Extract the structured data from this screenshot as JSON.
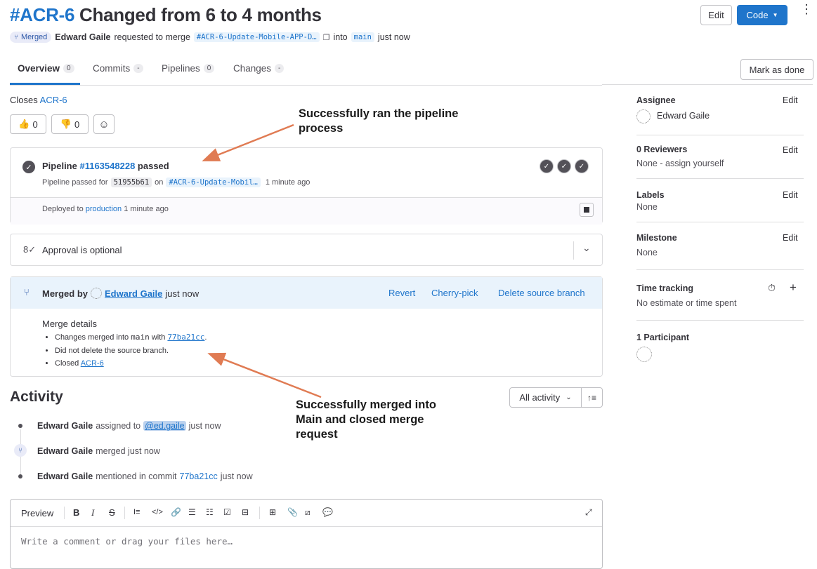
{
  "header": {
    "ref": "#ACR-6",
    "title_rest": " Changed from 6 to 4 months",
    "edit_label": "Edit",
    "code_label": "Code",
    "status_badge": "Merged",
    "author": "Edward Gaile",
    "requested_text": "requested to merge",
    "source_branch": "#ACR-6-Update-Mobile-APP-D…",
    "into_text": "into",
    "target_branch": "main",
    "time": "just now",
    "mark_done_label": "Mark as done"
  },
  "tabs": [
    {
      "label": "Overview",
      "count": "0"
    },
    {
      "label": "Commits",
      "count": "-"
    },
    {
      "label": "Pipelines",
      "count": "0"
    },
    {
      "label": "Changes",
      "count": "-"
    }
  ],
  "closes": {
    "prefix": "Closes",
    "issue": "ACR-6"
  },
  "reactions": {
    "thumbs_up": "0",
    "thumbs_down": "0"
  },
  "pipeline": {
    "prefix": "Pipeline",
    "id": "#1163548228",
    "status": "passed",
    "detail_prefix": "Pipeline passed for",
    "commit": "51955b61",
    "on_text": "on",
    "branch": "#ACR-6-Update-Mobil…",
    "time": "1 minute ago",
    "deploy_prefix": "Deployed to",
    "environment": "production",
    "deploy_time": "1 minute ago"
  },
  "approval": {
    "text": "Approval is optional"
  },
  "merged": {
    "prefix": "Merged by",
    "user": "Edward Gaile",
    "time": "just now",
    "revert": "Revert",
    "cherry_pick": "Cherry-pick",
    "delete_branch": "Delete source branch",
    "details_title": "Merge details",
    "bullet1_prefix": "Changes merged into",
    "bullet1_branch": "main",
    "bullet1_with": "with",
    "bullet1_commit": "77ba21cc",
    "bullet1_suffix": ".",
    "bullet2": "Did not delete the source branch.",
    "bullet3_prefix": "Closed",
    "bullet3_issue": "ACR-6"
  },
  "activity": {
    "title": "Activity",
    "filter": "All activity",
    "items": [
      {
        "user": "Edward Gaile",
        "action": "assigned to",
        "target": "@ed.gaile",
        "time": "just now"
      },
      {
        "user": "Edward Gaile",
        "action": "merged just now"
      },
      {
        "user": "Edward Gaile",
        "action": "mentioned in commit",
        "commit": "77ba21cc",
        "time": "just now"
      }
    ]
  },
  "editor": {
    "preview_label": "Preview",
    "placeholder": "Write a comment or drag your files here…"
  },
  "sidebar": {
    "assignee_label": "Assignee",
    "assignee_edit": "Edit",
    "assignee_name": "Edward Gaile",
    "reviewers_label": "0 Reviewers",
    "reviewers_edit": "Edit",
    "reviewers_value": "None - assign yourself",
    "labels_label": "Labels",
    "labels_edit": "Edit",
    "labels_value": "None",
    "milestone_label": "Milestone",
    "milestone_edit": "Edit",
    "milestone_value": "None",
    "time_label": "Time tracking",
    "time_value": "No estimate or time spent",
    "participants_label": "1 Participant"
  },
  "annotations": {
    "pipeline_line1": "Successfully ran the pipeline",
    "pipeline_line2": "process",
    "merge_line1": "Successfully merged into",
    "merge_line2": "Main and closed merge",
    "merge_line3": "request"
  },
  "colors": {
    "accent": "#1f75cb",
    "arrow": "#e07b53",
    "success": "#3f3f3f"
  }
}
